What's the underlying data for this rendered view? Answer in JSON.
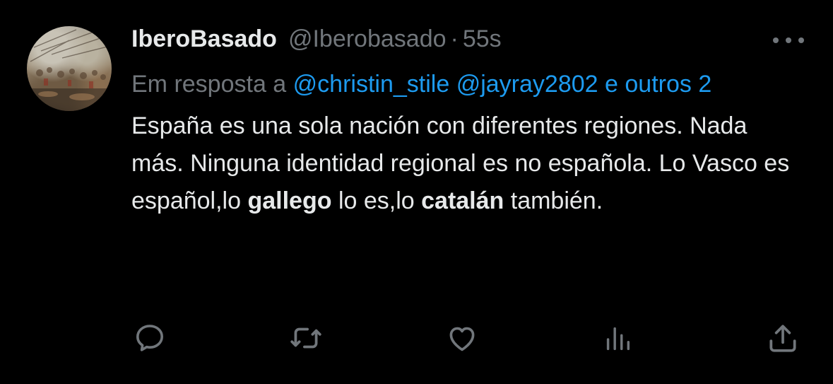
{
  "author": {
    "display_name": "IberoBasado",
    "handle": "@Iberobasado",
    "separator": "·",
    "timestamp": "55s"
  },
  "reply": {
    "prefix": "Em resposta a ",
    "mention_1": "@christin_stile",
    "mention_2": "@jayray2802",
    "mention_3": "e outros 2"
  },
  "body": {
    "part_1": "España es una sola nación con diferentes regiones. Nada más. Ninguna identidad regional es no española. Lo Vasco es español,lo ",
    "bold_1": "gallego",
    "part_2": " lo es,lo ",
    "bold_2": "catalán",
    "part_3": " también."
  },
  "icons": {
    "more": "more-horizontal-icon",
    "reply": "reply-icon",
    "retweet": "retweet-icon",
    "like": "heart-icon",
    "views": "views-icon",
    "share": "share-icon"
  },
  "colors": {
    "background": "#000000",
    "primary_text": "#e7e9ea",
    "secondary_text": "#71767b",
    "link": "#1d9bf0"
  }
}
